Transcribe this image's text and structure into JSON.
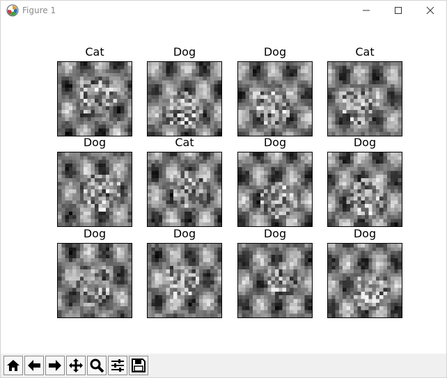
{
  "window": {
    "title": "Figure 1"
  },
  "figure": {
    "grid_rows": 3,
    "grid_cols": 4,
    "subplots": [
      {
        "title": "Cat",
        "tone": "gray"
      },
      {
        "title": "Dog",
        "tone": "gray"
      },
      {
        "title": "Dog",
        "tone": "gray"
      },
      {
        "title": "Cat",
        "tone": "gray"
      },
      {
        "title": "Dog",
        "tone": "gray"
      },
      {
        "title": "Cat",
        "tone": "gray"
      },
      {
        "title": "Dog",
        "tone": "gray"
      },
      {
        "title": "Dog",
        "tone": "gray"
      },
      {
        "title": "Dog",
        "tone": "gray"
      },
      {
        "title": "Dog",
        "tone": "gray"
      },
      {
        "title": "Dog",
        "tone": "gray"
      },
      {
        "title": "Dog",
        "tone": "gray"
      }
    ]
  },
  "toolbar": {
    "tools": [
      {
        "name": "home",
        "icon": "home-icon"
      },
      {
        "name": "back",
        "icon": "arrow-left-icon"
      },
      {
        "name": "forward",
        "icon": "arrow-right-icon"
      },
      {
        "name": "pan",
        "icon": "move-icon"
      },
      {
        "name": "zoom",
        "icon": "magnifier-icon"
      },
      {
        "name": "configure-subplots",
        "icon": "sliders-icon"
      },
      {
        "name": "save",
        "icon": "floppy-disk-icon"
      }
    ]
  }
}
